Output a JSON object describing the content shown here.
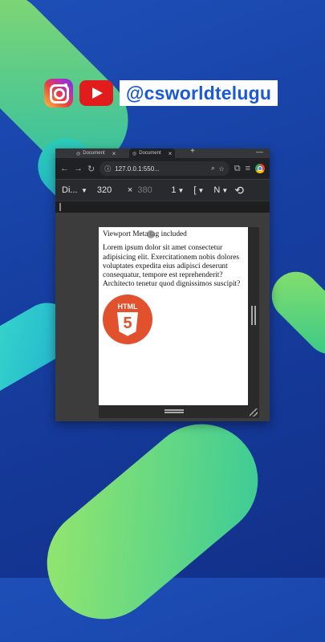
{
  "brand": {
    "handle": "@csworldtelugu"
  },
  "browser": {
    "tabs": [
      {
        "label": "Document"
      },
      {
        "label": "Document"
      }
    ],
    "new_tab": "+",
    "window_controls": "—",
    "nav": {
      "back": "←",
      "forward": "→",
      "reload": "↻"
    },
    "address": "127.0.0.1:550...",
    "devtools": {
      "device": "Di...",
      "width": "320",
      "times": "×",
      "height": "380",
      "zoom": "1",
      "throttle": "[",
      "more": "N"
    }
  },
  "page": {
    "heading": "Viewport Meta tag included",
    "paragraph": "Lorem ipsum dolor sit amet consectetur adipisicing elit. Exercitationem nobis dolores voluptates expedita eius adipisci deserunt consequatur, tempore est reprehenderit? Architecto tenetur quod dignissimos suscipit?",
    "logo_label": "HTML"
  },
  "colors": {
    "background": "#1d4fb8",
    "accent_green": "#8ee06a",
    "handle_blue": "#1a5ad6",
    "html5_orange": "#e2512d"
  }
}
